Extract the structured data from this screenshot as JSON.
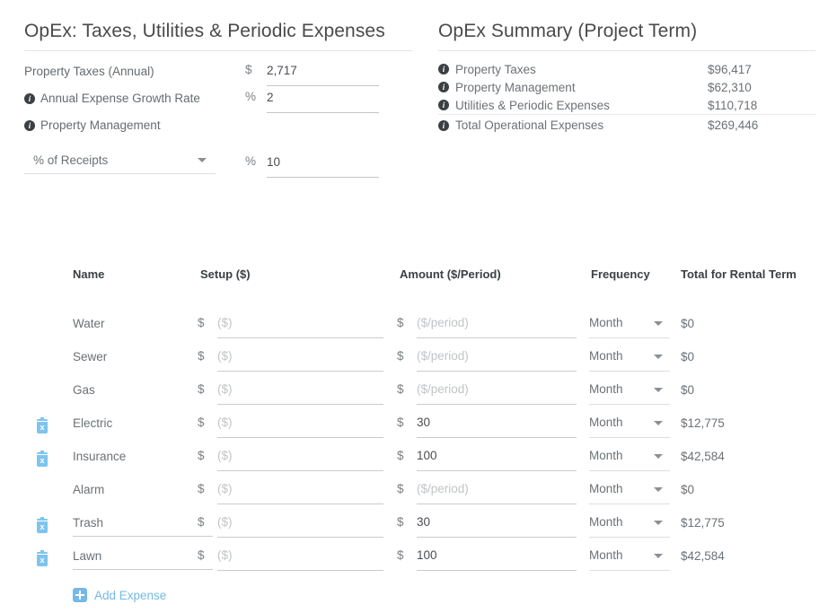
{
  "left_panel": {
    "title": "OpEx: Taxes, Utilities & Periodic Expenses",
    "rows": [
      {
        "label": "Property Taxes (Annual)",
        "has_info": false,
        "unit": "$",
        "value": "2,717",
        "underlined": true
      },
      {
        "label": "Annual Expense Growth Rate",
        "has_info": true,
        "unit": "%",
        "value": "2",
        "underlined": true
      },
      {
        "label": "Property Management",
        "has_info": true,
        "unit": "",
        "value": "",
        "underlined": false
      }
    ],
    "select": {
      "value": "% of Receipts",
      "unit": "%",
      "amount": "10"
    }
  },
  "right_panel": {
    "title": "OpEx Summary (Project Term)",
    "rows": [
      {
        "label": "Property Taxes",
        "value": "$96,417",
        "separator_above": false
      },
      {
        "label": "Property Management",
        "value": "$62,310",
        "separator_above": false
      },
      {
        "label": "Utilities & Periodic Expenses",
        "value": "$110,718",
        "separator_above": false
      },
      {
        "label": "Total Operational Expenses",
        "value": "$269,446",
        "separator_above": true
      }
    ]
  },
  "table": {
    "headers": {
      "name": "Name",
      "setup": "Setup ($)",
      "amount": "Amount ($/Period)",
      "frequency": "Frequency",
      "total": "Total for Rental Term"
    },
    "placeholders": {
      "setup": "($)",
      "amount": "($/period)"
    },
    "rows": [
      {
        "deletable": false,
        "name": "Water",
        "name_editable": false,
        "setup": "",
        "amount": "",
        "frequency": "Month",
        "total": "$0"
      },
      {
        "deletable": false,
        "name": "Sewer",
        "name_editable": false,
        "setup": "",
        "amount": "",
        "frequency": "Month",
        "total": "$0"
      },
      {
        "deletable": false,
        "name": "Gas",
        "name_editable": false,
        "setup": "",
        "amount": "",
        "frequency": "Month",
        "total": "$0"
      },
      {
        "deletable": true,
        "name": "Electric",
        "name_editable": false,
        "setup": "",
        "amount": "30",
        "frequency": "Month",
        "total": "$12,775"
      },
      {
        "deletable": true,
        "name": "Insurance",
        "name_editable": false,
        "setup": "",
        "amount": "100",
        "frequency": "Month",
        "total": "$42,584"
      },
      {
        "deletable": false,
        "name": "Alarm",
        "name_editable": false,
        "setup": "",
        "amount": "",
        "frequency": "Month",
        "total": "$0"
      },
      {
        "deletable": true,
        "name": "Trash",
        "name_editable": true,
        "setup": "",
        "amount": "30",
        "frequency": "Month",
        "total": "$12,775"
      },
      {
        "deletable": true,
        "name": "Lawn",
        "name_editable": true,
        "setup": "",
        "amount": "100",
        "frequency": "Month",
        "total": "$42,584"
      }
    ],
    "add_label": "Add Expense"
  },
  "icons": {
    "info": "i",
    "delete": "x"
  },
  "colors": {
    "accent": "#74b9e7",
    "text": "#6c7175",
    "heading": "#3c4043",
    "rule": "#e4e4e4"
  }
}
